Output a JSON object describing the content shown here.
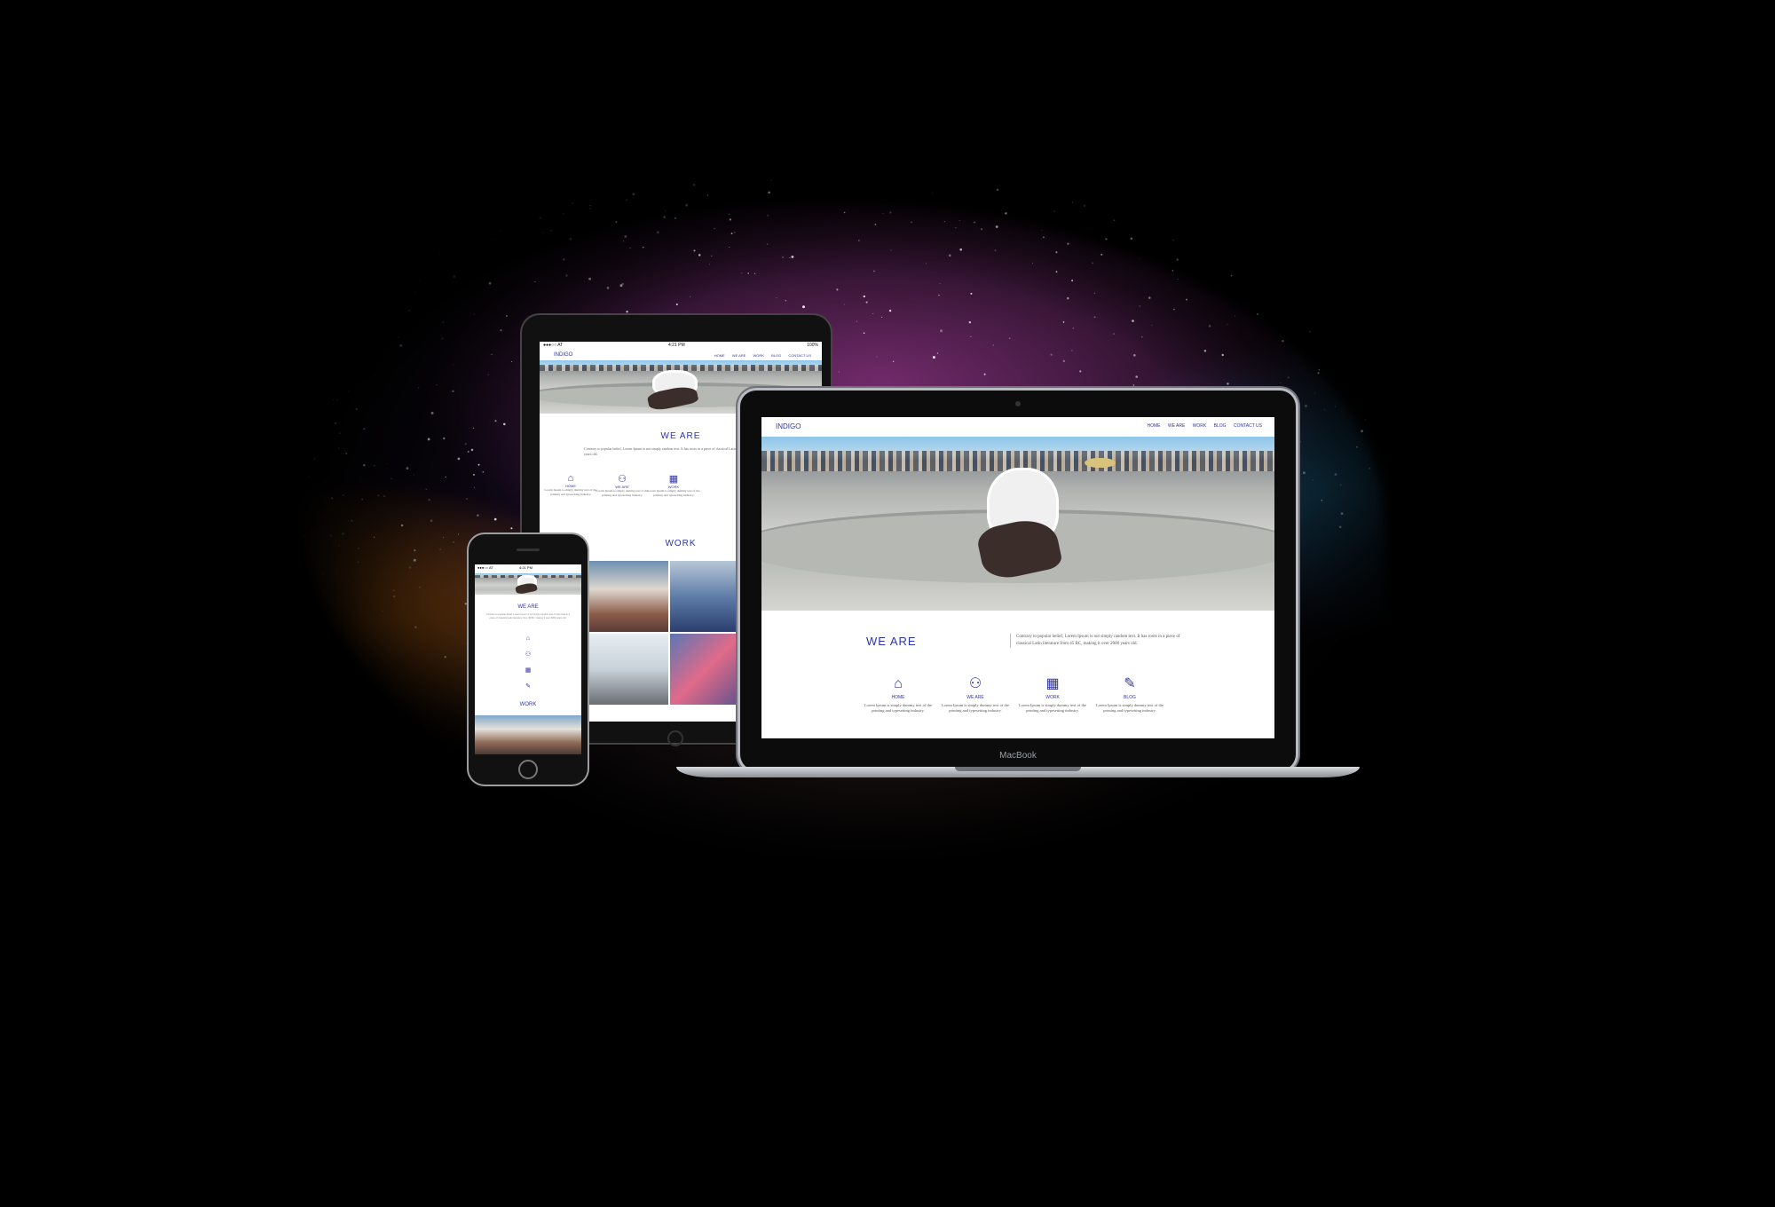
{
  "site": {
    "logo": "INDIGO",
    "nav": [
      "HOME",
      "WE ARE",
      "WORK",
      "BLOG",
      "CONTACT US"
    ],
    "we_are_title": "WE ARE",
    "we_are_body": "Contrary to popular belief, Lorem Ipsum is not simply random text. It has roots in a piece of classical Latin literature from 45 BC, making it over 2000 years old.",
    "features": [
      {
        "icon": "home-icon",
        "glyph": "⌂",
        "label": "HOME",
        "text": "Lorem Ipsum is simply dummy text of the printing and typesetting industry."
      },
      {
        "icon": "people-icon",
        "glyph": "⚇",
        "label": "WE ARE",
        "text": "Lorem Ipsum is simply dummy text of the printing and typesetting industry."
      },
      {
        "icon": "layout-icon",
        "glyph": "▦",
        "label": "WORK",
        "text": "Lorem Ipsum is simply dummy text of the printing and typesetting industry."
      },
      {
        "icon": "pencil-icon",
        "glyph": "✎",
        "label": "BLOG",
        "text": "Lorem Ipsum is simply dummy text of the printing and typesetting industry."
      }
    ],
    "work_title": "WORK",
    "accent_color": "#2e35a8"
  },
  "laptop": {
    "brand": "MacBook"
  },
  "tablet": {
    "carrier": "●●●○○ AT",
    "time": "4:21 PM",
    "battery": "100%"
  },
  "phone": {
    "carrier": "●●●○○ AT",
    "time": "4:21 PM"
  }
}
